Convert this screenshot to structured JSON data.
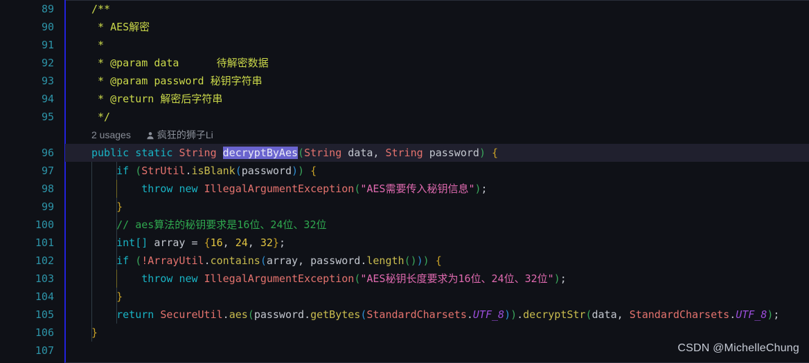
{
  "editor": {
    "language": "java",
    "first_line": 89,
    "last_line": 107,
    "current_line": 96,
    "selected_text": "decryptByAes",
    "line_numbers": [
      89,
      90,
      91,
      92,
      93,
      94,
      95,
      96,
      97,
      98,
      99,
      100,
      101,
      102,
      103,
      104,
      105,
      106,
      107
    ],
    "inlay_hint": {
      "usages": "2 usages",
      "author": "疯狂的狮子Li",
      "icon": "person-icon"
    },
    "lines": {
      "l89": "/**",
      "l90": " * AES解密",
      "l91": " *",
      "l92": " * @param data      待解密数据",
      "l93": " * @param password 秘钥字符串",
      "l94": " * @return 解密后字符串",
      "l95": " */",
      "l96": "public static String decryptByAes(String data, String password) {",
      "l97": "    if (StrUtil.isBlank(password)) {",
      "l98": "        throw new IllegalArgumentException(\"AES需要传入秘钥信息\");",
      "l99": "    }",
      "l100": "    // aes算法的秘钥要求是16位、24位、32位",
      "l101": "    int[] array = {16, 24, 32};",
      "l102": "    if (!ArrayUtil.contains(array, password.length())) {",
      "l103": "        throw new IllegalArgumentException(\"AES秘钥长度要求为16位、24位、32位\");",
      "l104": "    }",
      "l105": "    return SecureUtil.aes(password.getBytes(StandardCharsets.UTF_8)).decryptStr(data, StandardCharsets.UTF_8);",
      "l106": "}",
      "l107": ""
    },
    "tokens": {
      "jdoc_open": "/**",
      "jdoc_star": "*",
      "jdoc_title": "AES解密",
      "jdoc_param": "@param",
      "jdoc_data": "data",
      "jdoc_data_desc": "待解密数据",
      "jdoc_password": "password",
      "jdoc_password_desc": "秘钥字符串",
      "jdoc_return": "@return",
      "jdoc_return_desc": "解密后字符串",
      "jdoc_close": "*/",
      "kw_public": "public",
      "kw_static": "static",
      "kw_if": "if",
      "kw_throw": "throw",
      "kw_new": "new",
      "kw_int": "int",
      "kw_return": "return",
      "type_String": "String",
      "type_StrUtil": "StrUtil",
      "type_IllegalArgumentException": "IllegalArgumentException",
      "type_ArrayUtil": "ArrayUtil",
      "type_SecureUtil": "SecureUtil",
      "type_StandardCharsets": "StandardCharsets",
      "m_decryptByAes": "decryptByAes",
      "m_isBlank": "isBlank",
      "m_contains": "contains",
      "m_length": "length",
      "m_aes": "aes",
      "m_getBytes": "getBytes",
      "m_decryptStr": "decryptStr",
      "id_data": "data",
      "id_password": "password",
      "id_array": "array",
      "const_UTF_8": "UTF_8",
      "str_need_key": "\"AES需要传入秘钥信息\"",
      "str_key_len": "\"AES秘钥长度要求为16位、24位、32位\"",
      "comment_aes": "// aes算法的秘钥要求是16位、24位、32位",
      "num_16": "16",
      "num_24": "24",
      "num_32": "32"
    }
  },
  "watermark": {
    "text": "CSDN @MichelleChung"
  },
  "colors": {
    "background": "#0f1117",
    "current_line": "#20202e",
    "line_number": "#2d94a8",
    "gutter_marker": "#2222dd",
    "selection": "#6a64cf",
    "keyword": "#19b3c4",
    "type": "#e5736e",
    "method": "#c9bc4e",
    "string": "#e06ab0",
    "number": "#e0c341",
    "javadoc": "#cbd94a",
    "line_comment": "#2fa84f",
    "brace": "#c9a227",
    "static_field": "#9b4edb",
    "identifier": "#c3c7cf",
    "watermark": "#c7ccd6"
  }
}
